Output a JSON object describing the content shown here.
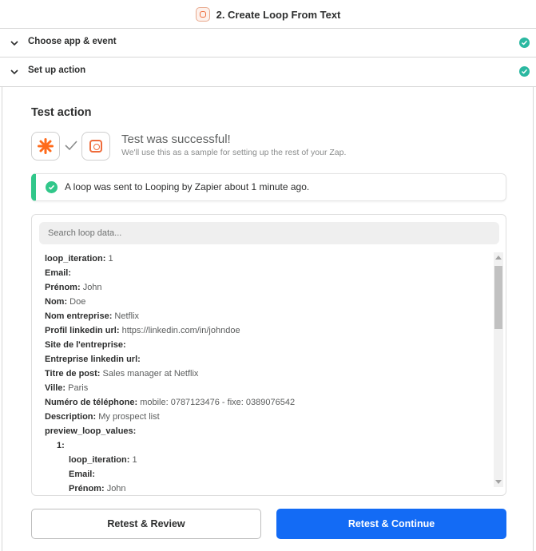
{
  "header": {
    "title": "2. Create Loop From Text",
    "icon": "loop-icon"
  },
  "sections": [
    {
      "label": "Choose app & event",
      "status": "complete",
      "icon": "check-icon"
    },
    {
      "label": "Set up action",
      "status": "complete",
      "icon": "check-icon"
    }
  ],
  "test": {
    "title": "Test action",
    "success_title": "Test was successful!",
    "success_subtitle": "We'll use this as a sample for setting up the rest of your Zap.",
    "trigger_app_icon": "zapier-asterisk-icon",
    "action_app_icon": "looping-icon",
    "alert_text": "A loop was sent to Looping by Zapier about 1 minute ago."
  },
  "search": {
    "placeholder": "Search loop data..."
  },
  "data_lines": [
    {
      "key": "loop_iteration:",
      "value": "1"
    },
    {
      "key": "Email:",
      "value": ""
    },
    {
      "key": "Prénom:",
      "value": "John"
    },
    {
      "key": "Nom:",
      "value": "Doe"
    },
    {
      "key": "Nom entreprise:",
      "value": "Netflix"
    },
    {
      "key": "Profil linkedin url:",
      "value": "https://linkedin.com/in/johndoe"
    },
    {
      "key": "Site de l'entreprise:",
      "value": ""
    },
    {
      "key": "Entreprise linkedin url:",
      "value": ""
    },
    {
      "key": "Titre de post:",
      "value": "Sales manager at Netflix"
    },
    {
      "key": "Ville:",
      "value": "Paris"
    },
    {
      "key": "Numéro de téléphone:",
      "value": "mobile: 0787123476 - fixe: 0389076542"
    },
    {
      "key": "Description:",
      "value": "My prospect list"
    },
    {
      "key": "preview_loop_values:",
      "value": ""
    },
    {
      "key": "1:",
      "value": ""
    },
    {
      "key": "loop_iteration:",
      "value": "1"
    },
    {
      "key": "Email:",
      "value": ""
    },
    {
      "key": "Prénom:",
      "value": "John"
    }
  ],
  "buttons": {
    "review": "Retest & Review",
    "continue": "Retest & Continue"
  },
  "colors": {
    "accent": "#136bf5",
    "success": "#31c78a",
    "step_complete": "#2bb8a1",
    "brand_orange": "#ef6b3a"
  }
}
